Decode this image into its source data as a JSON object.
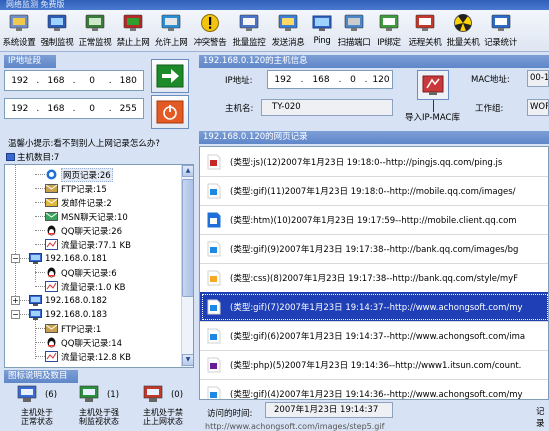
{
  "window": {
    "title": "网络监测 免费版"
  },
  "toolbar": {
    "buttons": [
      {
        "label": "系统设置",
        "icon": "system-settings-icon"
      },
      {
        "label": "强制监视",
        "icon": "monitor-icon"
      },
      {
        "label": "正常监视",
        "icon": "normal-monitor-icon"
      },
      {
        "label": "禁止上网",
        "icon": "block-internet-icon"
      },
      {
        "label": "允许上网",
        "icon": "allow-internet-icon"
      },
      {
        "label": "冲突警告",
        "icon": "warning-icon"
      },
      {
        "label": "批量监控",
        "icon": "batch-monitor-icon"
      },
      {
        "label": "发送消息",
        "icon": "send-message-icon"
      },
      {
        "label": "Ping",
        "icon": "ping-icon"
      },
      {
        "label": "扫描端口",
        "icon": "scan-port-icon"
      },
      {
        "label": "IP绑定",
        "icon": "ip-bind-icon"
      },
      {
        "label": "远程关机",
        "icon": "remote-shutdown-icon"
      },
      {
        "label": "批量关机",
        "icon": "batch-shutdown-icon"
      },
      {
        "label": "记录统计",
        "icon": "record-stats-icon"
      }
    ]
  },
  "ip_range": {
    "title": "IP地址段",
    "start": [
      "192",
      "168",
      "0",
      "180"
    ],
    "end": [
      "192",
      "168",
      "0",
      "255"
    ]
  },
  "hint": "温馨小提示:看不到别人上网记录怎么办?",
  "host_count_label": "主机数目:7",
  "tree": {
    "nodes": [
      {
        "label": "网页记录:26",
        "icon": "ie-icon",
        "selected": true
      },
      {
        "label": "FTP记录:15",
        "icon": "ftp-icon"
      },
      {
        "label": "发邮件记录:2",
        "icon": "mail-icon"
      },
      {
        "label": "MSN聊天记录:10",
        "icon": "msn-icon"
      },
      {
        "label": "QQ聊天记录:26",
        "icon": "qq-icon"
      },
      {
        "label": "流量记录:77.1 KB",
        "icon": "traffic-icon"
      },
      {
        "label": "192.168.0.181",
        "icon": "host-icon"
      },
      {
        "label": "QQ聊天记录:6",
        "icon": "qq-icon"
      },
      {
        "label": "流量记录:1.0 KB",
        "icon": "traffic-icon"
      },
      {
        "label": "192.168.0.182",
        "icon": "host-icon"
      },
      {
        "label": "192.168.0.183",
        "icon": "host-icon"
      },
      {
        "label": "FTP记录:1",
        "icon": "ftp-icon"
      },
      {
        "label": "QQ聊天记录:14",
        "icon": "qq-icon"
      },
      {
        "label": "流量记录:12.8 KB",
        "icon": "traffic-icon"
      }
    ]
  },
  "legend": {
    "title": "图标说明及数目",
    "items": [
      {
        "count": "(6)",
        "line1": "主机处于",
        "line2": "正常状态"
      },
      {
        "count": "(1)",
        "line1": "主机处于强",
        "line2": "制监视状态"
      },
      {
        "count": "(0)",
        "line1": "主机处于禁",
        "line2": "止上网状态"
      }
    ]
  },
  "host_info": {
    "title": "192.168.0.120的主机信息",
    "ip_label": "IP地址:",
    "ip_value": [
      "192",
      "168",
      "0",
      "120"
    ],
    "host_label": "主机名:",
    "host_value": "TY-020",
    "import_label": "导入IP-MAC库",
    "mac_label": "MAC地址:",
    "mac_value": "00-1",
    "workgroup_label": "工作组:",
    "workgroup_value": "WORK"
  },
  "records": {
    "title": "192.168.0.120的网页记录",
    "rows": [
      {
        "text": "(类型:js)(12)2007年1月23日  19:18:0--http://pingjs.qq.com/ping.js",
        "icon": "js-file-icon"
      },
      {
        "text": "(类型:gif)(11)2007年1月23日  19:18:0--http://mobile.qq.com/images/",
        "icon": "gif-file-icon"
      },
      {
        "text": "(类型:htm)(10)2007年1月23日  19:17:59--http://mobile.client.qq.com",
        "icon": "htm-file-icon"
      },
      {
        "text": "(类型:gif)(9)2007年1月23日  19:17:38--http://bank.qq.com/images/bg",
        "icon": "gif-file-icon"
      },
      {
        "text": "(类型:css)(8)2007年1月23日  19:17:38--http://bank.qq.com/style/myF",
        "icon": "css-file-icon"
      },
      {
        "text": "(类型:gif)(7)2007年1月23日  19:14:37--http://www.achongsoft.com/my",
        "icon": "gif-file-icon",
        "selected": true
      },
      {
        "text": "(类型:gif)(6)2007年1月23日  19:14:37--http://www.achongsoft.com/ima",
        "icon": "gif-file-icon"
      },
      {
        "text": "(类型:php)(5)2007年1月23日  19:14:36--http://www1.itsun.com/count.",
        "icon": "php-file-icon"
      },
      {
        "text": "(类型:gif)(4)2007年1月23日  19:14:36--http://www.achongsoft.com/my",
        "icon": "gif-file-icon"
      }
    ]
  },
  "footer": {
    "visit_time_label": "访问的时间:",
    "visit_time_value": "2007年1月23日 19:14:37",
    "right_label": "记录",
    "url_partial": "http://www.achongsoft.com/images/step5.gif"
  },
  "colors": {
    "selection": "#1e3fb6",
    "panel": "#d7e3f4",
    "section_header": "#6a8fcf"
  }
}
